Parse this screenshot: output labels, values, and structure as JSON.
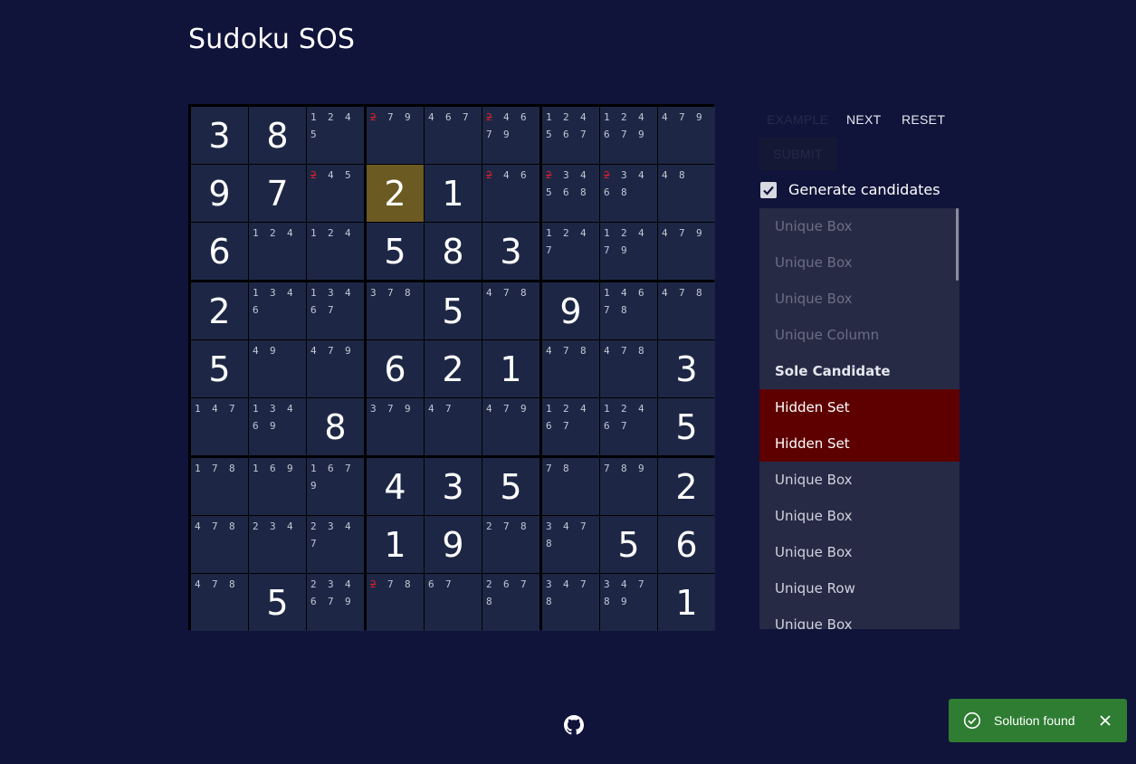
{
  "app": {
    "title": "Sudoku SOS"
  },
  "controls": {
    "example_label": "EXAMPLE",
    "next_label": "NEXT",
    "reset_label": "RESET",
    "submit_label": "SUBMIT",
    "generate_candidates_label": "Generate candidates",
    "generate_candidates_checked": true
  },
  "board": {
    "selected_cell": [
      1,
      3
    ],
    "grid": [
      [
        {
          "v": "3"
        },
        {
          "v": "8"
        },
        {
          "c": [
            "1",
            "2",
            "4",
            "5"
          ]
        },
        {
          "c": [
            "2",
            "7",
            "9"
          ],
          "x": [
            "2"
          ]
        },
        {
          "c": [
            "4",
            "6",
            "7"
          ]
        },
        {
          "c": [
            "2",
            "4",
            "6",
            "7",
            "9"
          ],
          "x": [
            "2"
          ]
        },
        {
          "c": [
            "1",
            "2",
            "4",
            "5",
            "6",
            "7"
          ]
        },
        {
          "c": [
            "1",
            "2",
            "4",
            "6",
            "7",
            "9"
          ]
        },
        {
          "c": [
            "4",
            "7",
            "9"
          ]
        }
      ],
      [
        {
          "v": "9"
        },
        {
          "v": "7"
        },
        {
          "c": [
            "2",
            "4",
            "5"
          ],
          "x": [
            "2"
          ]
        },
        {
          "v": "2"
        },
        {
          "v": "1"
        },
        {
          "c": [
            "2",
            "4",
            "6"
          ],
          "x": [
            "2"
          ]
        },
        {
          "c": [
            "2",
            "3",
            "4",
            "5",
            "6",
            "8"
          ],
          "x": [
            "2"
          ]
        },
        {
          "c": [
            "2",
            "3",
            "4",
            "6",
            "8"
          ],
          "x": [
            "2"
          ]
        },
        {
          "c": [
            "4",
            "8"
          ]
        }
      ],
      [
        {
          "v": "6"
        },
        {
          "c": [
            "1",
            "2",
            "4"
          ]
        },
        {
          "c": [
            "1",
            "2",
            "4"
          ]
        },
        {
          "v": "5"
        },
        {
          "v": "8"
        },
        {
          "v": "3"
        },
        {
          "c": [
            "1",
            "2",
            "4",
            "7"
          ]
        },
        {
          "c": [
            "1",
            "2",
            "4",
            "7",
            "9"
          ]
        },
        {
          "c": [
            "4",
            "7",
            "9"
          ]
        }
      ],
      [
        {
          "v": "2"
        },
        {
          "c": [
            "1",
            "3",
            "4",
            "6"
          ]
        },
        {
          "c": [
            "1",
            "3",
            "4",
            "6",
            "7"
          ]
        },
        {
          "c": [
            "3",
            "7",
            "8"
          ]
        },
        {
          "v": "5"
        },
        {
          "c": [
            "4",
            "7",
            "8"
          ]
        },
        {
          "v": "9"
        },
        {
          "c": [
            "1",
            "4",
            "6",
            "7",
            "8"
          ]
        },
        {
          "c": [
            "4",
            "7",
            "8"
          ]
        }
      ],
      [
        {
          "v": "5"
        },
        {
          "c": [
            "4",
            "9"
          ]
        },
        {
          "c": [
            "4",
            "7",
            "9"
          ]
        },
        {
          "v": "6"
        },
        {
          "v": "2"
        },
        {
          "v": "1"
        },
        {
          "c": [
            "4",
            "7",
            "8"
          ]
        },
        {
          "c": [
            "4",
            "7",
            "8"
          ]
        },
        {
          "v": "3"
        }
      ],
      [
        {
          "c": [
            "1",
            "4",
            "7"
          ]
        },
        {
          "c": [
            "1",
            "3",
            "4",
            "6",
            "9"
          ]
        },
        {
          "v": "8"
        },
        {
          "c": [
            "3",
            "7",
            "9"
          ]
        },
        {
          "c": [
            "4",
            "7"
          ]
        },
        {
          "c": [
            "4",
            "7",
            "9"
          ]
        },
        {
          "c": [
            "1",
            "2",
            "4",
            "6",
            "7"
          ]
        },
        {
          "c": [
            "1",
            "2",
            "4",
            "6",
            "7"
          ]
        },
        {
          "v": "5"
        }
      ],
      [
        {
          "c": [
            "1",
            "7",
            "8"
          ]
        },
        {
          "c": [
            "1",
            "6",
            "9"
          ]
        },
        {
          "c": [
            "1",
            "6",
            "7",
            "9"
          ]
        },
        {
          "v": "4"
        },
        {
          "v": "3"
        },
        {
          "v": "5"
        },
        {
          "c": [
            "7",
            "8"
          ]
        },
        {
          "c": [
            "7",
            "8",
            "9"
          ]
        },
        {
          "v": "2"
        }
      ],
      [
        {
          "c": [
            "4",
            "7",
            "8"
          ]
        },
        {
          "c": [
            "2",
            "3",
            "4"
          ]
        },
        {
          "c": [
            "2",
            "3",
            "4",
            "7"
          ]
        },
        {
          "v": "1"
        },
        {
          "v": "9"
        },
        {
          "c": [
            "2",
            "7",
            "8"
          ]
        },
        {
          "c": [
            "3",
            "4",
            "7",
            "8"
          ]
        },
        {
          "v": "5"
        },
        {
          "v": "6"
        }
      ],
      [
        {
          "c": [
            "4",
            "7",
            "8"
          ]
        },
        {
          "v": "5"
        },
        {
          "c": [
            "2",
            "3",
            "4",
            "6",
            "7",
            "9"
          ]
        },
        {
          "c": [
            "2",
            "7",
            "8"
          ],
          "x": [
            "2"
          ]
        },
        {
          "c": [
            "6",
            "7"
          ]
        },
        {
          "c": [
            "2",
            "6",
            "7",
            "8"
          ]
        },
        {
          "c": [
            "3",
            "4",
            "7",
            "8"
          ]
        },
        {
          "c": [
            "3",
            "4",
            "7",
            "8",
            "9"
          ]
        },
        {
          "v": "1"
        }
      ]
    ]
  },
  "steps": [
    {
      "label": "Unique Box",
      "state": "past"
    },
    {
      "label": "Unique Box",
      "state": "past"
    },
    {
      "label": "Unique Box",
      "state": "past"
    },
    {
      "label": "Unique Column",
      "state": "past"
    },
    {
      "label": "Sole Candidate",
      "state": "current"
    },
    {
      "label": "Hidden Set",
      "state": "highlight"
    },
    {
      "label": "Hidden Set",
      "state": "highlight"
    },
    {
      "label": "Unique Box",
      "state": "future"
    },
    {
      "label": "Unique Box",
      "state": "future"
    },
    {
      "label": "Unique Box",
      "state": "future"
    },
    {
      "label": "Unique Row",
      "state": "future"
    },
    {
      "label": "Unique Box",
      "state": "future"
    }
  ],
  "toast": {
    "message": "Solution found",
    "status_color": "#2e7d32"
  },
  "icons": {
    "github": "github-icon",
    "toast_success": "check-circle-icon",
    "toast_close": "close-icon",
    "checkbox": "check-icon"
  }
}
